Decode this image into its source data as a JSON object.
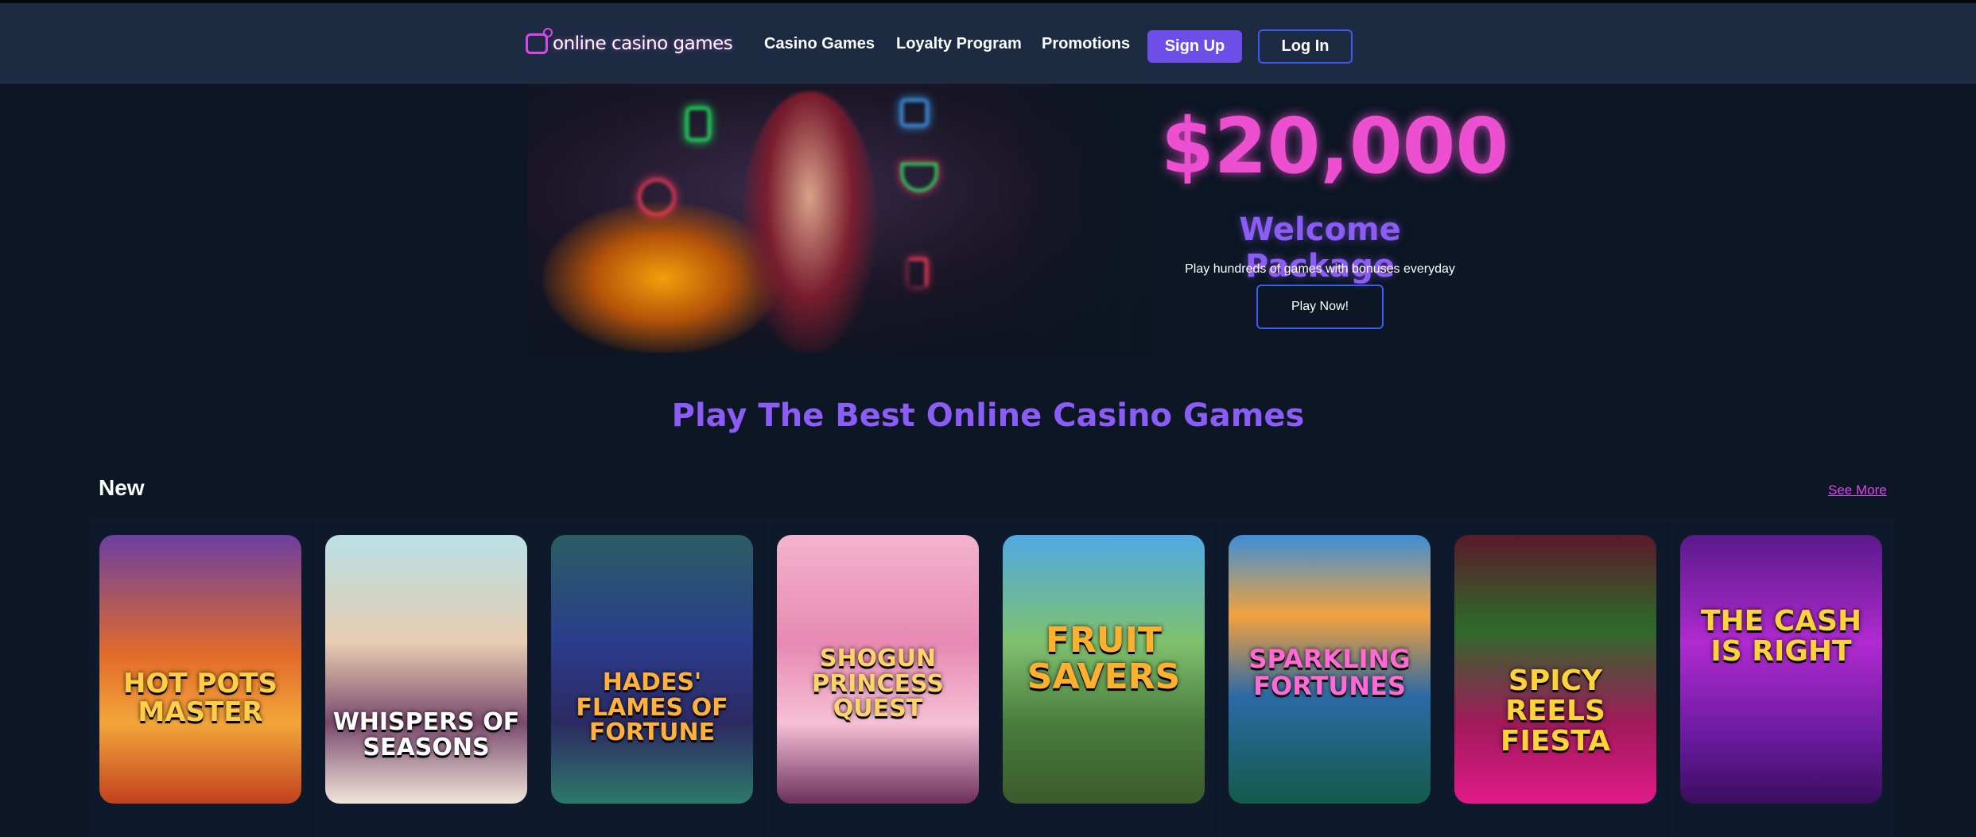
{
  "header": {
    "logo_text": "online casino games",
    "nav": [
      "Casino Games",
      "Loyalty Program",
      "Promotions"
    ],
    "signup_label": "Sign Up",
    "login_label": "Log In"
  },
  "hero": {
    "amount": "$20,000",
    "title": "Welcome Package",
    "subtitle": "Play hundreds of games with bonuses everyday",
    "cta_label": "Play Now!"
  },
  "section": {
    "title": "Play The Best Online Casino Games"
  },
  "row": {
    "title": "New",
    "see_more": "See More",
    "games": [
      {
        "name": "HOT POTS MASTER"
      },
      {
        "name": "WHISPERS OF SEASONS"
      },
      {
        "name": "HADES' FLAMES OF FORTUNE"
      },
      {
        "name": "SHOGUN PRINCESS QUEST"
      },
      {
        "name": "FRUIT SAVERS"
      },
      {
        "name": "SPARKLING FORTUNES"
      },
      {
        "name": "SPICY REELS FIESTA"
      },
      {
        "name": "THE CASH IS RIGHT"
      }
    ]
  },
  "colors": {
    "background": "#0c1624",
    "header": "#1c2b42",
    "accent_purple": "#8b5cf6",
    "accent_pink": "#ec4fd0",
    "button_purple": "#6d4ee8",
    "outline_blue": "#3b5cf0"
  }
}
